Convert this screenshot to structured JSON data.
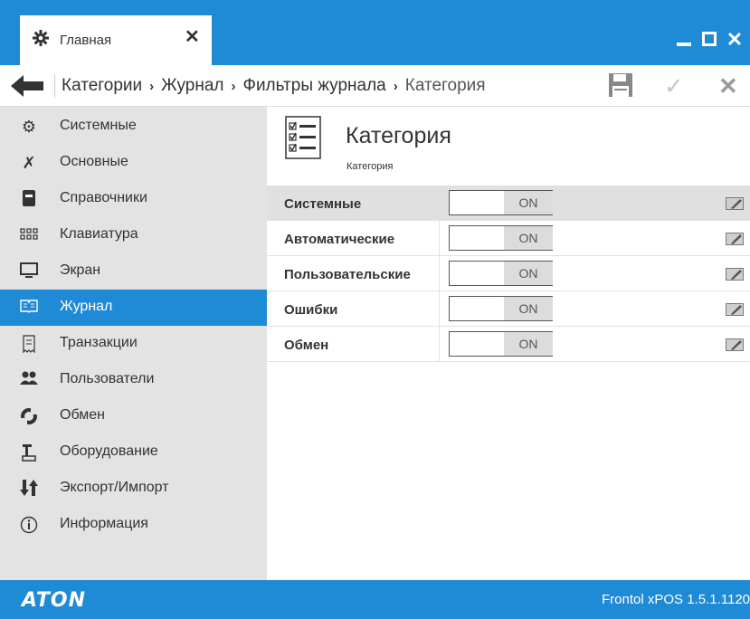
{
  "window": {
    "tab_title": "Главная",
    "icons": {
      "tab": "gear-icon",
      "close": "close-icon",
      "minimize": "minimize-icon",
      "maximize": "maximize-icon",
      "window_close": "close-icon"
    }
  },
  "toolbar": {
    "breadcrumb": [
      {
        "label": "Категории"
      },
      {
        "label": "Журнал"
      },
      {
        "label": "Фильтры журнала"
      },
      {
        "label": "Категория"
      }
    ],
    "icons": {
      "back": "back-arrow-icon",
      "save": "save-icon",
      "ok": "checkmark-icon",
      "cancel": "cancel-icon"
    }
  },
  "sidebar": {
    "items": [
      {
        "label": "Системные",
        "icon": "gears-icon",
        "active": false
      },
      {
        "label": "Основные",
        "icon": "tools-icon",
        "active": false
      },
      {
        "label": "Справочники",
        "icon": "book-icon",
        "active": false
      },
      {
        "label": "Клавиатура",
        "icon": "keyboard-icon",
        "active": false
      },
      {
        "label": "Экран",
        "icon": "monitor-icon",
        "active": false
      },
      {
        "label": "Журнал",
        "icon": "journal-icon",
        "active": true
      },
      {
        "label": "Транзакции",
        "icon": "receipt-icon",
        "active": false
      },
      {
        "label": "Пользователи",
        "icon": "users-icon",
        "active": false
      },
      {
        "label": "Обмен",
        "icon": "sync-icon",
        "active": false
      },
      {
        "label": "Оборудование",
        "icon": "equipment-icon",
        "active": false
      },
      {
        "label": "Экспорт/Импорт",
        "icon": "import-export-icon",
        "active": false
      },
      {
        "label": "Информация",
        "icon": "info-icon",
        "active": false
      }
    ]
  },
  "main": {
    "title": "Категория",
    "subtitle": "Категория",
    "rows": [
      {
        "label": "Системные",
        "value": "ON"
      },
      {
        "label": "Автоматические",
        "value": "ON"
      },
      {
        "label": "Пользовательские",
        "value": "ON"
      },
      {
        "label": "Ошибки",
        "value": "ON"
      },
      {
        "label": "Обмен",
        "value": "ON"
      }
    ]
  },
  "footer": {
    "logo": "ATON",
    "version": "Frontol xPOS 1.5.1.1120"
  },
  "colors": {
    "accent": "#1f8ad6",
    "sidebar_bg": "#e3e3e3",
    "active_row": "#e0e0e0"
  }
}
